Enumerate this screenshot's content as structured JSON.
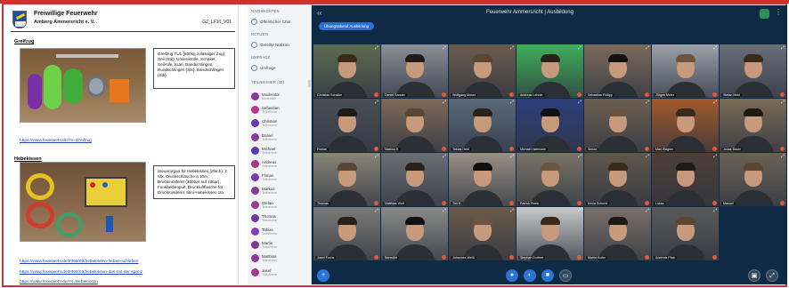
{
  "document": {
    "title": "Freiwillige Feuerwehr",
    "subtitle": "Amberg Ammersricht e. V.",
    "code": "GZ_LF10_V01",
    "sections": [
      {
        "title": "Greifzug",
        "description": "Greifzug TU1 (800kg zulässiger Zug), Seil (Stk), Umlenkrolle, Schäkel, Seilrolle, Kran, Bandschlingen, Rundschlingen (Stk), Bandschlingen (Stk)",
        "link": "https://www.feuerwehr.de/?s=Greifzug"
      },
      {
        "title": "Hebekissen",
        "description": "Steuerorgan für Hebekissen (2fach), 2 Stk. Druckschläuche a 10m, Druckminderer (300bar auf 10bar), Funkbedienpult, Druckluftflasche für Druckminderer, Mini-Hebekissen 1to",
        "links": [
          "https://www.feuerwehr.de/2003/03/hebekissen-heben-schieben",
          "https://www.feuerwehr.de/2003/03/hebekissen-das-mit-der-spreiz",
          "https://www.feuerwehr.de/?s=Hebekissen"
        ]
      }
    ]
  },
  "sidebar": {
    "headers": [
      "Nachrichten",
      "Notizen",
      "Umfrage",
      "Teilnehmer (32)"
    ],
    "items": [
      {
        "label": "Öffentlicher Chat",
        "icon": "chat-icon"
      },
      {
        "label": "Geteilte Notizen",
        "icon": "notes-icon"
      },
      {
        "label": "Umfrage",
        "icon": "poll-icon"
      }
    ],
    "users": [
      {
        "name": "Moderator",
        "role": "Moderator",
        "color": "#8a3a9e"
      },
      {
        "name": "Sebastian",
        "role": "Teilnehmer",
        "color": "#b23a8a"
      },
      {
        "name": "Christian",
        "role": "Teilnehmer",
        "color": "#6a3aa8"
      },
      {
        "name": "Daniel",
        "role": "Teilnehmer",
        "color": "#8a3a9e"
      },
      {
        "name": "Michael",
        "role": "Teilnehmer",
        "color": "#5c3aa8"
      },
      {
        "name": "Andreas",
        "role": "Teilnehmer",
        "color": "#a83a7a"
      },
      {
        "name": "Florian",
        "role": "Teilnehmer",
        "color": "#7a3aa8"
      },
      {
        "name": "Markus",
        "role": "Teilnehmer",
        "color": "#8a3a9e"
      },
      {
        "name": "Stefan",
        "role": "Teilnehmer",
        "color": "#9a3a8e"
      },
      {
        "name": "Thomas",
        "role": "Teilnehmer",
        "color": "#6a3a9e"
      },
      {
        "name": "Tobias",
        "role": "Teilnehmer",
        "color": "#8a3aae"
      },
      {
        "name": "Martin",
        "role": "Teilnehmer",
        "color": "#7a3a8e"
      },
      {
        "name": "Matthias",
        "role": "Teilnehmer",
        "color": "#8a3a9e"
      },
      {
        "name": "Josef",
        "role": "Teilnehmer",
        "color": "#a03a8e"
      }
    ]
  },
  "meeting": {
    "room_title": "Feuerwehr Ammersricht | Ausbildung",
    "tag": "Übungsabend Ausbildung",
    "tiles": [
      {
        "name": "Christian Schaller"
      },
      {
        "name": "Daniel Sander"
      },
      {
        "name": "Wolfgang Moser"
      },
      {
        "name": "Andreas Lehner"
      },
      {
        "name": "Sebastian Philipp"
      },
      {
        "name": "Jürgen Meier"
      },
      {
        "name": "Stefan Mirkl"
      },
      {
        "name": "Florian"
      },
      {
        "name": "Markus R."
      },
      {
        "name": "Tobias Held"
      },
      {
        "name": "Michael Hartmann"
      },
      {
        "name": "Simon"
      },
      {
        "name": "Max Wagner"
      },
      {
        "name": "Jonas Bauer"
      },
      {
        "name": "Thomas"
      },
      {
        "name": "Matthias Wolf"
      },
      {
        "name": "Tim K."
      },
      {
        "name": "Patrick Frank"
      },
      {
        "name": "Kevin Schmid"
      },
      {
        "name": "Lukas"
      },
      {
        "name": "Manuel"
      },
      {
        "name": "Josef Fuchs"
      },
      {
        "name": "Benedikt"
      },
      {
        "name": "Johannes Weiß"
      },
      {
        "name": "Stephan Dorfner"
      },
      {
        "name": "Martin Koller"
      },
      {
        "name": "Andreas Pfab"
      }
    ]
  },
  "toolbar": {
    "buttons": [
      "plus-icon",
      "microphone-icon",
      "headset-icon",
      "camera-icon",
      "screen-share-icon",
      "settings-icon",
      "fullscreen-icon"
    ]
  },
  "colors": {
    "frame": "#d0312d",
    "app_bg": "#0e2a44",
    "accent": "#2a74d8"
  }
}
